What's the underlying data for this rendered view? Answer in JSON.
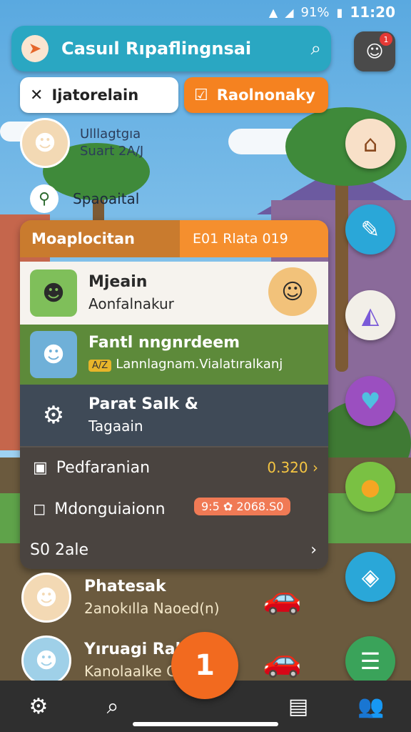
{
  "status_bar": {
    "battery": "91%",
    "time": "11:20",
    "icons": [
      "wifi-icon",
      "signal-icon",
      "battery-icon"
    ]
  },
  "app_bar": {
    "title": "Casuıl Rıpaflingnsai",
    "logo_icon": "navigation-arrow-icon",
    "search_icon": "search-icon"
  },
  "chat_button": {
    "icon": "chat-icon",
    "badge": "1"
  },
  "chips": [
    {
      "label": "Ijatorelain",
      "icon": "close-icon",
      "glyph": "✕"
    },
    {
      "label": "Raolnonaky",
      "icon": "checkbox-icon",
      "glyph": "☑"
    }
  ],
  "profile": {
    "line1": "Ulllagtgıa",
    "line2": "Suart 2A/J"
  },
  "location": {
    "label": "Spaoaital",
    "icon": "map-pin-icon"
  },
  "panel": {
    "header_left": "Moaplocitan",
    "header_right": "E01 Rlata 019",
    "rows": [
      {
        "title": "Mjeain",
        "subtitle": "Aonfalnakur"
      },
      {
        "title": "Fantl nngnrdeem",
        "badge": "A/Z",
        "subtitle": "Lannlagnam.Vialatıralkanj"
      },
      {
        "title": "Parat Salk &",
        "subtitle": "Tagaain"
      }
    ],
    "detail_1": {
      "label": "Pedfaranian",
      "value": "0.320 ›",
      "icon": "document-icon"
    },
    "detail_2": {
      "label": "Mdonguiaionn",
      "pill": "9:5 ✿ 2068.S0",
      "icon": "square-icon"
    },
    "detail_3": {
      "label": "S0 2ale",
      "chevron": "›"
    }
  },
  "friends": [
    {
      "name": "Phatesak",
      "subtitle": "2anokılla Naoed(n)"
    },
    {
      "name": "Yıruagi Ral",
      "subtitle": "Kanolaalke Car"
    }
  ],
  "side_buttons": [
    "shop-icon",
    "edit-icon",
    "map-icon",
    "heart-icon",
    "medal-icon",
    "scan-icon",
    "list-icon"
  ],
  "fab": {
    "label": "1"
  },
  "bottom_nav": [
    "settings-icon",
    "search-icon",
    "gallery-icon",
    "people-icon"
  ]
}
